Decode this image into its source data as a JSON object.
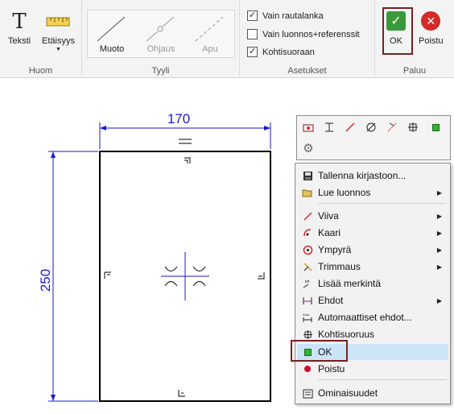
{
  "ribbon": {
    "groups": {
      "huom": {
        "label": "Huom",
        "buttons": [
          {
            "label": "Teksti",
            "icon": "text-icon"
          },
          {
            "label": "Etäisyys",
            "icon": "ruler-icon"
          }
        ]
      },
      "tyyli": {
        "label": "Tyyli",
        "styles": [
          {
            "label": "Muoto",
            "icon": "solid-line-icon"
          },
          {
            "label": "Ohjaus",
            "icon": "guide-line-icon"
          },
          {
            "label": "Apu",
            "icon": "dashed-line-icon"
          }
        ]
      },
      "asetukset": {
        "label": "Asetukset",
        "checkboxes": [
          {
            "label": "Vain rautalanka",
            "checked": true
          },
          {
            "label": "Vain luonnos+referenssit",
            "checked": false
          },
          {
            "label": "Kohtisuoraan",
            "checked": true
          }
        ]
      },
      "paluu": {
        "label": "Paluu",
        "buttons": [
          {
            "label": "OK",
            "icon": "checkmark-icon",
            "color": "#3a9a3a"
          },
          {
            "label": "Poistu",
            "icon": "close-icon",
            "color": "#d42a2a"
          }
        ]
      }
    }
  },
  "drawing": {
    "width_dim": "170",
    "height_dim": "250",
    "dim_color": "#1a1acc"
  },
  "context_menu": {
    "items": [
      {
        "label": "Tallenna kirjastoon...",
        "icon": "save-icon",
        "submenu": false
      },
      {
        "label": "Lue luonnos",
        "icon": "open-folder-icon",
        "submenu": true
      },
      {
        "label": "Viiva",
        "icon": "line-icon",
        "submenu": true
      },
      {
        "label": "Kaari",
        "icon": "arc-icon",
        "submenu": true
      },
      {
        "label": "Ympyrä",
        "icon": "circle-icon",
        "submenu": true
      },
      {
        "label": "Trimmaus",
        "icon": "trim-icon",
        "submenu": true
      },
      {
        "label": "Lisää merkintä",
        "icon": "annotation-icon",
        "submenu": false
      },
      {
        "label": "Ehdot",
        "icon": "constraints-icon",
        "submenu": true
      },
      {
        "label": "Automaattiset ehdot...",
        "icon": "auto-constraints-icon",
        "submenu": false
      },
      {
        "label": "Kohtisuoruus",
        "icon": "perpendicular-icon",
        "submenu": false
      },
      {
        "label": "OK",
        "icon": "ok-square-icon",
        "submenu": false
      },
      {
        "label": "Poistu",
        "icon": "exit-dot-icon",
        "submenu": false
      },
      {
        "label": "Ominaisuudet",
        "icon": "properties-icon",
        "submenu": false
      }
    ]
  },
  "mini_toolbar": {
    "icons": [
      "rectangle-tool-icon",
      "dimension-tool-icon",
      "line-tool-icon",
      "diameter-tool-icon",
      "angle-tool-icon",
      "grid-tool-icon",
      "ok-square-icon",
      "gear-icon"
    ]
  }
}
